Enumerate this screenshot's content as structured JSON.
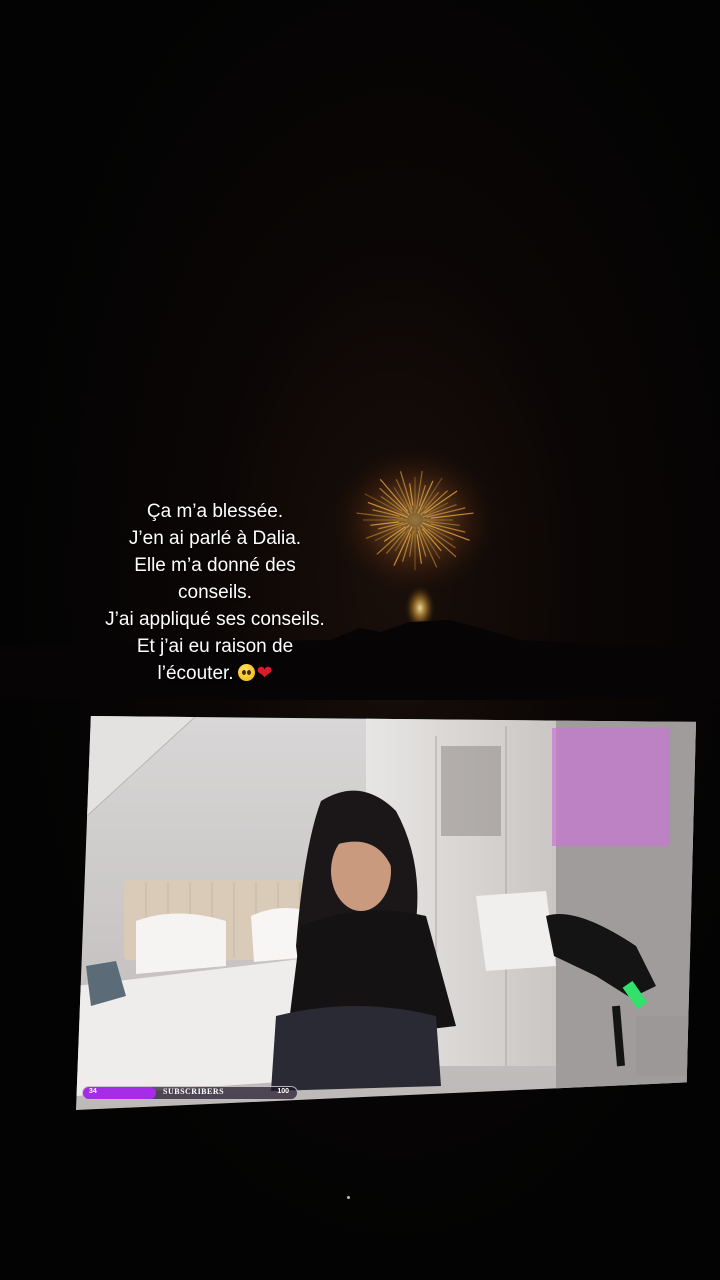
{
  "caption": {
    "lines": [
      "Ça m’a blessée.",
      "J’en ai parlé à Dalia.",
      "Elle m’a donné des",
      "conseils.",
      "J’ai appliqué ses conseils.",
      "Et j’ai eu raison de",
      "l’écouter."
    ],
    "emoji_1": "pleading-face-emoji",
    "emoji_2": "❤"
  },
  "stream": {
    "subscriber_goal": {
      "current": "34",
      "label": "SUBSCRIBERS",
      "goal": "100",
      "progress": 0.34,
      "fill_color": "#a52de8"
    },
    "chat_overlay_color": "#c878d2",
    "chat_lines": [
      "",
      "",
      "",
      "",
      "",
      "",
      "",
      "",
      "",
      "",
      "",
      ""
    ]
  },
  "colors": {
    "background": "#020202",
    "firework": "#ffb347",
    "caption_text": "#ffffff"
  }
}
